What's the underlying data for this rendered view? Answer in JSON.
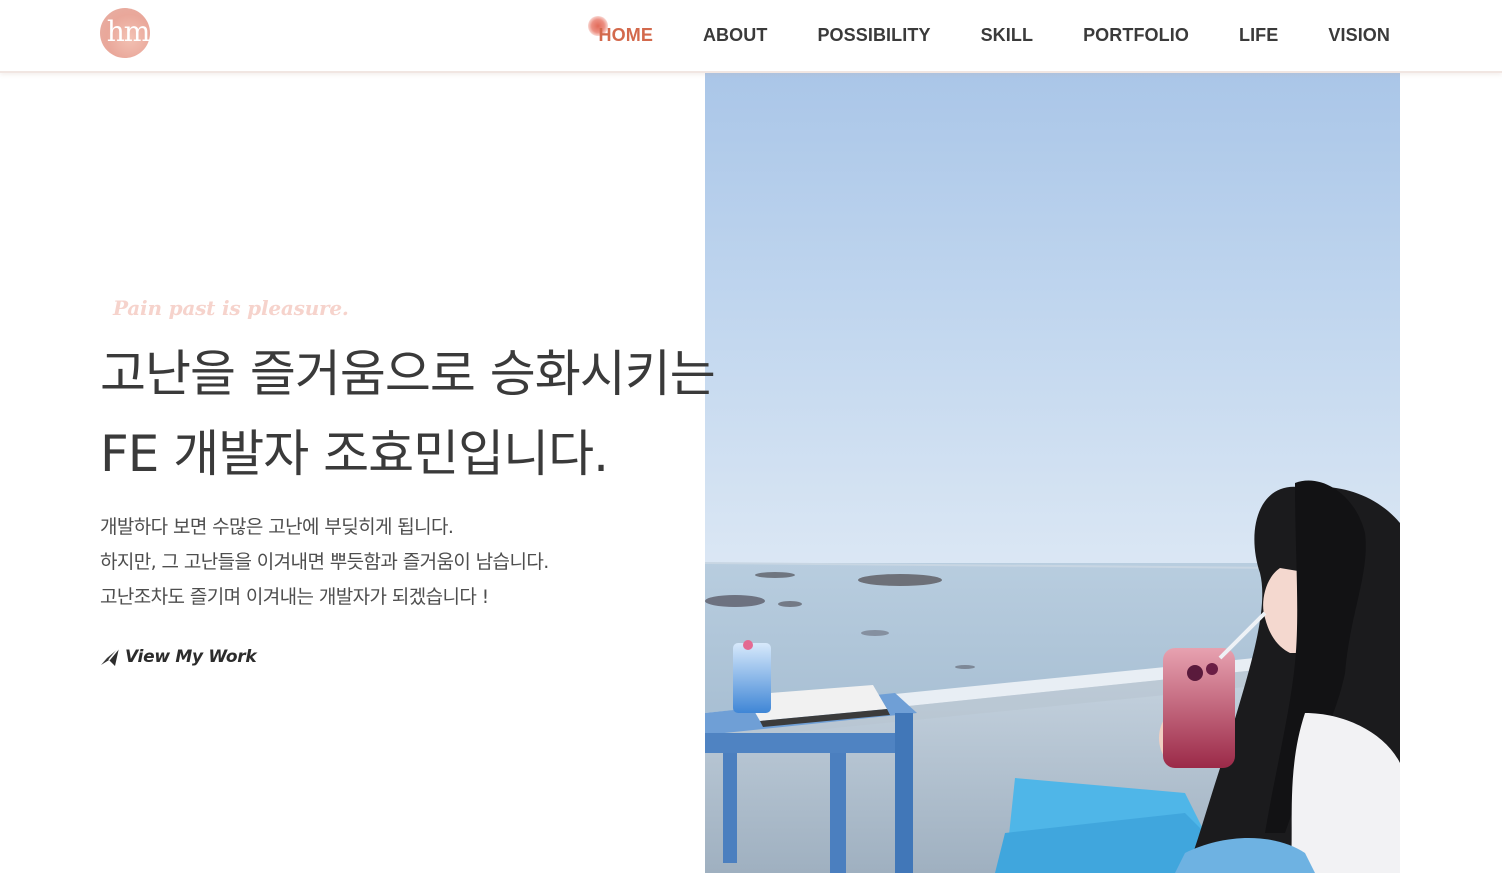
{
  "header": {
    "logo_text": "hm",
    "nav": [
      {
        "label": "HOME",
        "active": true
      },
      {
        "label": "ABOUT",
        "active": false
      },
      {
        "label": "POSSIBILITY",
        "active": false
      },
      {
        "label": "SKILL",
        "active": false
      },
      {
        "label": "PORTFOLIO",
        "active": false
      },
      {
        "label": "LIFE",
        "active": false
      },
      {
        "label": "VISION",
        "active": false
      }
    ]
  },
  "hero": {
    "motto": "Pain past is pleasure.",
    "headline": [
      "고난을 즐거움으로 승화시키는",
      "FE 개발자 조효민입니다."
    ],
    "description": [
      "개발하다 보면 수많은 고난에 부딪히게 됩니다.",
      "하지만, 그 고난들을 이겨내면 뿌듯함과 즐거움이 남습니다.",
      "고난조차도 즐기며 이겨내는 개발자가 되겠습니다 !"
    ],
    "cta_label": "View My Work",
    "cta_icon": "paper-plane-icon",
    "photo": "seaside-cafe-photo"
  },
  "colors": {
    "accent": "#d3694c",
    "nav_text": "#3a3a3a",
    "motto": "#f6d3cc",
    "headline": "#3a3a3a",
    "body_text": "#4e4e4e"
  }
}
